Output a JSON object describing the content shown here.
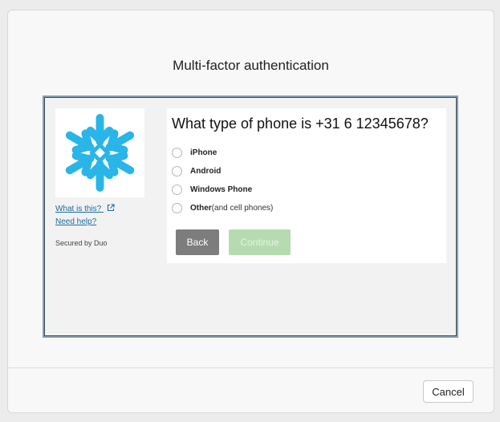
{
  "dialog": {
    "title": "Multi-factor authentication",
    "cancel_label": "Cancel"
  },
  "duo": {
    "logo_color": "#29b5e8",
    "links": {
      "what_is_this": "What is this?",
      "need_help": "Need help?"
    },
    "secured_by": "Secured by Duo",
    "question": "What type of phone is +31 6 12345678?",
    "options": [
      {
        "label": "iPhone",
        "suffix": ""
      },
      {
        "label": "Android",
        "suffix": ""
      },
      {
        "label": "Windows Phone",
        "suffix": ""
      },
      {
        "label": "Other",
        "suffix": " (and cell phones)"
      }
    ],
    "back_label": "Back",
    "continue_label": "Continue"
  },
  "icons": {
    "logo": "snowflake-icon",
    "external_link": "external-link-icon",
    "radio": "radio-unchecked-icon"
  }
}
